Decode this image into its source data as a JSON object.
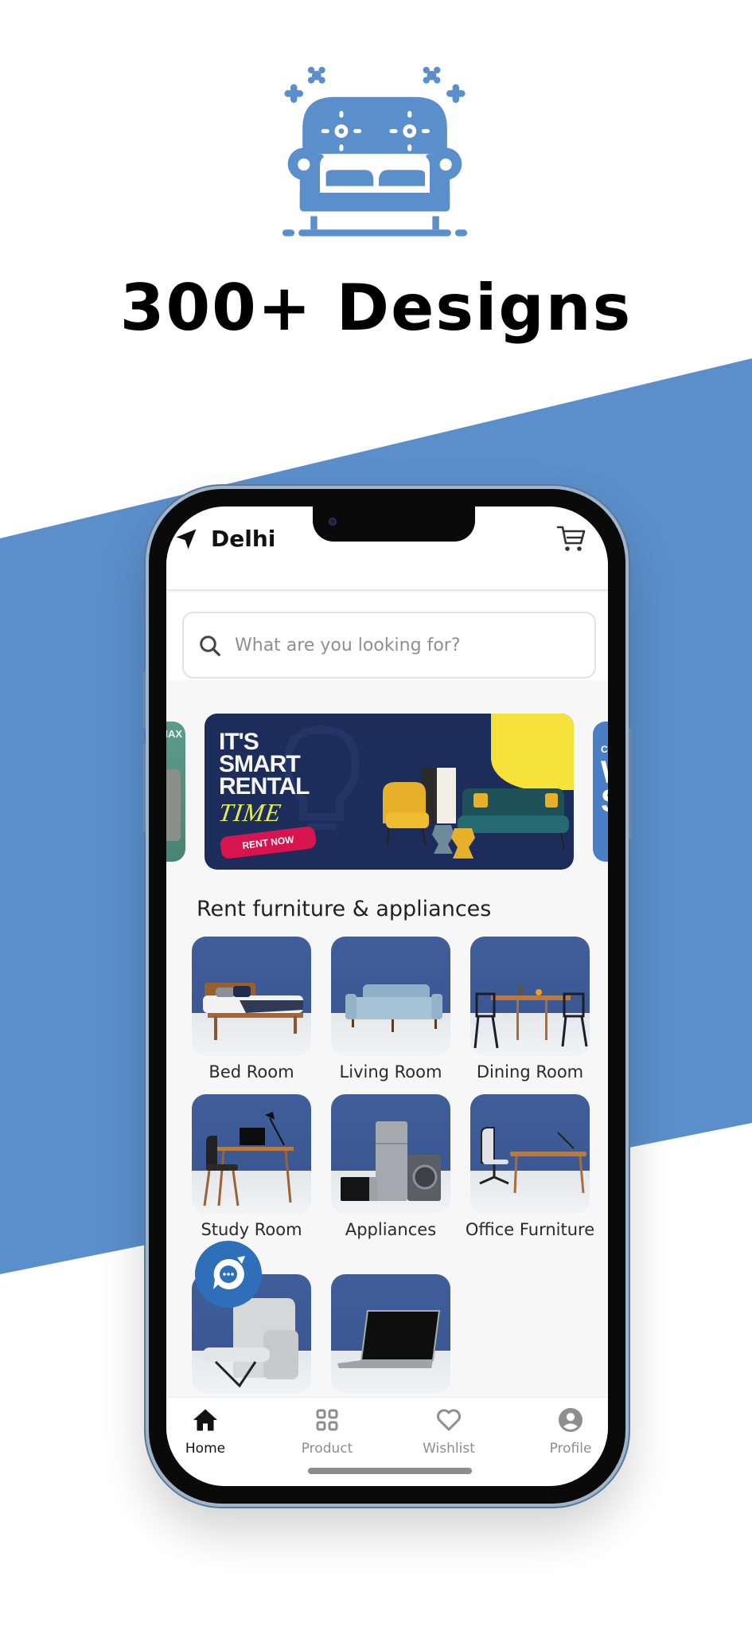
{
  "hero": {
    "title": "300+ Designs",
    "icon": "sofa-icon",
    "accent": "#5b8fcb"
  },
  "app": {
    "location": "Delhi",
    "location_icon": "navigation-arrow-icon",
    "cart_icon": "cart-icon",
    "search": {
      "placeholder": "What are you looking for?",
      "value": ""
    },
    "carousel": {
      "left_peek_text": "MAX",
      "main_banner": {
        "line1": "IT'S",
        "line2": "SMART",
        "line3": "RENTAL",
        "line4": "TIME",
        "cta": "RENT NOW"
      },
      "right_peek_text": "Ch"
    },
    "section_title": "Rent furniture & appliances",
    "categories": [
      {
        "label": "Bed Room",
        "image": "bed"
      },
      {
        "label": "Living Room",
        "image": "sofa"
      },
      {
        "label": "Dining Room",
        "image": "dining-table"
      },
      {
        "label": "Study Room",
        "image": "study-desk"
      },
      {
        "label": "Appliances",
        "image": "fridge-washer-microwave"
      },
      {
        "label": "Office Furniture",
        "image": "office-desk"
      },
      {
        "label": "",
        "image": "recliner"
      },
      {
        "label": "",
        "image": "laptop"
      }
    ],
    "chat_button_icon": "chat-bubble-icon",
    "bottom_nav": [
      {
        "label": "Home",
        "icon": "home-icon",
        "active": true
      },
      {
        "label": "Product",
        "icon": "grid-icon",
        "active": false
      },
      {
        "label": "Wishlist",
        "icon": "heart-icon",
        "active": false
      },
      {
        "label": "Profile",
        "icon": "user-circle-icon",
        "active": false
      }
    ]
  }
}
